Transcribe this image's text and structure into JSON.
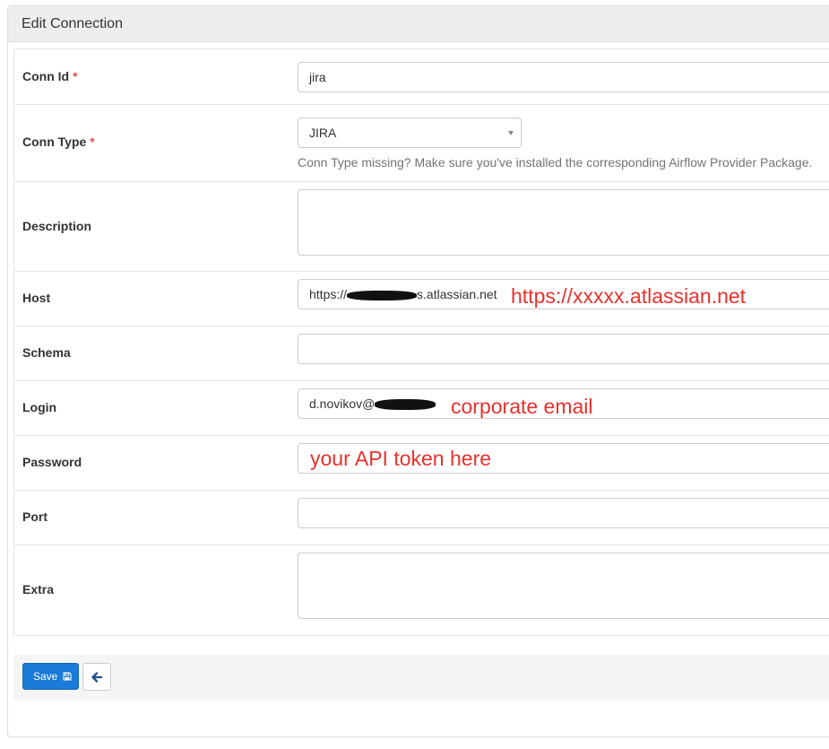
{
  "panel": {
    "title": "Edit Connection"
  },
  "fields": {
    "conn_id": {
      "label": "Conn Id",
      "required_mark": "*",
      "value": "jira"
    },
    "conn_type": {
      "label": "Conn Type",
      "required_mark": "*",
      "value": "JIRA",
      "help": "Conn Type missing? Make sure you've installed the corresponding Airflow Provider Package."
    },
    "description": {
      "label": "Description",
      "value": ""
    },
    "host": {
      "label": "Host",
      "value_prefix": "https://",
      "value_suffix": "s.atlassian.net"
    },
    "schema": {
      "label": "Schema",
      "value": ""
    },
    "login": {
      "label": "Login",
      "value_prefix": "d.novikov@"
    },
    "password": {
      "label": "Password",
      "value": ""
    },
    "port": {
      "label": "Port",
      "value": ""
    },
    "extra": {
      "label": "Extra",
      "value": ""
    }
  },
  "annotations": {
    "host": "https://xxxxx.atlassian.net",
    "login": "corporate email",
    "password": "your API token here"
  },
  "buttons": {
    "save_label": "Save"
  },
  "icons": {
    "save": "floppy-disk-icon",
    "back": "arrow-left-icon",
    "select": "caret-down-icon"
  },
  "colors": {
    "primary": "#1a7bd8",
    "annotation": "#e8322c",
    "required": "#d9534f"
  }
}
